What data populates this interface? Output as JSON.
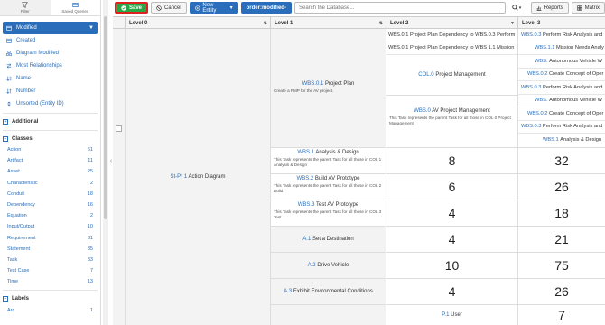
{
  "sidebar": {
    "tabs": [
      {
        "label": "Filter",
        "icon": "filter-icon"
      },
      {
        "label": "Saved Queries",
        "icon": "saved-queries-icon"
      }
    ],
    "sort_options": [
      {
        "label": "Modified",
        "icon": "calendar-icon",
        "active": true
      },
      {
        "label": "Created",
        "icon": "calendar-icon"
      },
      {
        "label": "Diagram Modified",
        "icon": "diagram-icon"
      },
      {
        "label": "Most Relationships",
        "icon": "relationships-icon"
      },
      {
        "label": "Name",
        "icon": "sort-alpha-icon"
      },
      {
        "label": "Number",
        "icon": "sort-numeric-icon"
      },
      {
        "label": "Unsorted (Entity ID)",
        "icon": "unsorted-icon"
      }
    ],
    "additional_label": "Additional",
    "classes_label": "Classes",
    "classes": [
      {
        "name": "Action",
        "count": "61"
      },
      {
        "name": "Artifact",
        "count": "11"
      },
      {
        "name": "Asset",
        "count": "25"
      },
      {
        "name": "Characteristic",
        "count": "2"
      },
      {
        "name": "Conduit",
        "count": "18"
      },
      {
        "name": "Dependency",
        "count": "16"
      },
      {
        "name": "Equation",
        "count": "2"
      },
      {
        "name": "Input/Output",
        "count": "10"
      },
      {
        "name": "Requirement",
        "count": "31"
      },
      {
        "name": "Statement",
        "count": "85"
      },
      {
        "name": "Task",
        "count": "33"
      },
      {
        "name": "Test Case",
        "count": "7"
      },
      {
        "name": "Time",
        "count": "13"
      }
    ],
    "labels_label": "Labels",
    "labels": [
      {
        "name": "Arc",
        "count": "1"
      }
    ]
  },
  "toolbar": {
    "save": "Save",
    "cancel": "Cancel",
    "new_entity": "New Entity",
    "order": "order:modified-",
    "search_placeholder": "Search the Database...",
    "reports": "Reports",
    "matrix": "Matrix"
  },
  "grid": {
    "headers": [
      "Level 0",
      "Level 1",
      "Level 2",
      "Level 3"
    ],
    "level0": {
      "id": "St-Pr 1",
      "name": "Action Diagram"
    },
    "level1": [
      {
        "id": "WBS.0.1",
        "name": "Project Plan",
        "desc": "Create a PMP for the AV project."
      },
      {
        "id": "WBS.1",
        "name": "Analysis & Design",
        "desc": "This Task represents the parent Task for all those in COL 1 Analysis & Design"
      },
      {
        "id": "WBS.2",
        "name": "Build AV Prototype",
        "desc": "This Task represents the parent Task for all those in COL 2 Build"
      },
      {
        "id": "WBS.3",
        "name": "Test AV Prototype",
        "desc": "This Task represents the parent Task for all those in COL 3 Test"
      },
      {
        "id": "A.1",
        "name": "Set a Destination"
      },
      {
        "id": "A.2",
        "name": "Drive Vehicle"
      },
      {
        "id": "A.3",
        "name": "Exhibit Environmental Conditions"
      },
      {
        "id": "",
        "name": ""
      }
    ],
    "level2_top": [
      "WBS.0.1 Project Plan Dependency to WBS.0.3 Perform",
      "WBS.0.1 Project Plan Dependency to WBS 1.1 Mission"
    ],
    "level2": [
      {
        "id": "COL.0",
        "name": "Project Management"
      },
      {
        "id": "WBS.0",
        "name": "AV Project Management",
        "desc": "This Task represents the parent Task for all those in COL 0 Project Management"
      }
    ],
    "level2_counts": [
      "8",
      "6",
      "4",
      "4",
      "10",
      "4"
    ],
    "level2_last": {
      "id": "P.1",
      "name": "User"
    },
    "level3": [
      {
        "id": "WBS.0.3",
        "name": "Perform Risk Analysis and"
      },
      {
        "id": "WBS.1.1",
        "name": "Mission Needs Analy"
      },
      {
        "id": "WBS.",
        "name": "Autonomous Vehicle W"
      },
      {
        "id": "WBS.0.2",
        "name": "Create Concept of Oper"
      },
      {
        "id": "WBS.0.3",
        "name": "Perform Risk Analysis and"
      },
      {
        "id": "WBS.",
        "name": "Autonomous Vehicle W"
      },
      {
        "id": "WBS.0.2",
        "name": "Create Concept of Oper"
      },
      {
        "id": "WBS.0.3",
        "name": "Perform Risk Analysis and"
      },
      {
        "id": "WBS.1",
        "name": "Analysis & Design"
      }
    ],
    "level3_counts": [
      "32",
      "26",
      "18",
      "21",
      "75",
      "26",
      "7"
    ]
  }
}
